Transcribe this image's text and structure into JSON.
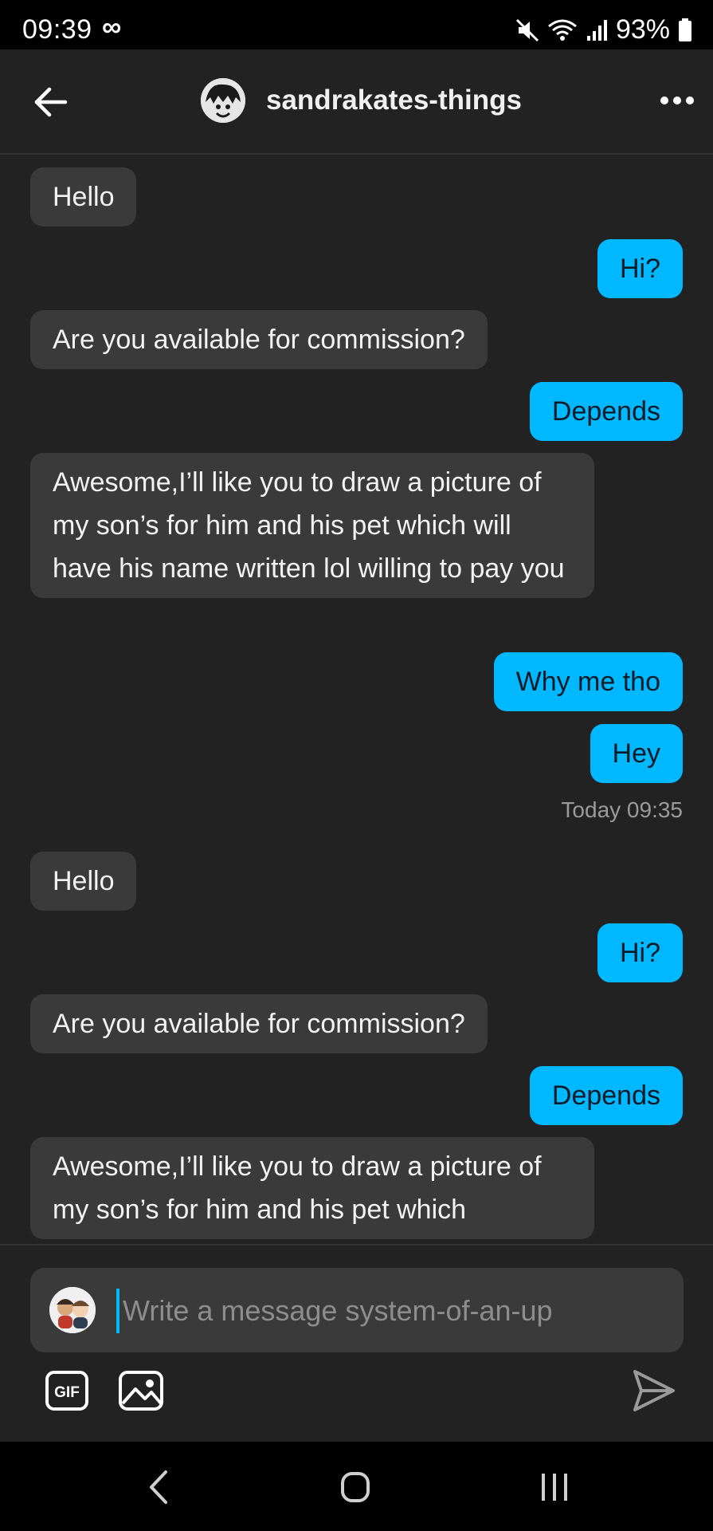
{
  "status_bar": {
    "time": "09:39",
    "infinity": "∞",
    "battery": "93%"
  },
  "header": {
    "title": "sandrakates-things"
  },
  "messages": [
    {
      "dir": "in",
      "text": "Hello"
    },
    {
      "dir": "out",
      "text": "Hi?"
    },
    {
      "dir": "in",
      "text": "Are you available for commission?"
    },
    {
      "dir": "out",
      "text": "Depends"
    },
    {
      "dir": "in",
      "text": "Awesome,I’ll like you to draw a picture of my son’s for him and his pet which will have his name written lol willing to pay you"
    },
    {
      "dir": "out",
      "text": "Why me tho"
    },
    {
      "dir": "out",
      "text": "Hey"
    },
    {
      "dir": "in",
      "text": "Hello"
    },
    {
      "dir": "out",
      "text": "Hi?"
    },
    {
      "dir": "in",
      "text": "Are you available for commission?"
    },
    {
      "dir": "out",
      "text": "Depends"
    },
    {
      "dir": "in",
      "text": "Awesome,I’ll like you to draw a picture of my son’s for him and his pet which"
    }
  ],
  "timestamp": "Today 09:35",
  "composer": {
    "placeholder": "Write a message system-of-an-up",
    "gif_label": "GIF"
  },
  "colors": {
    "outgoing_bubble": "#00b8ff",
    "incoming_bubble": "#3a3a3a",
    "background": "#222222"
  }
}
